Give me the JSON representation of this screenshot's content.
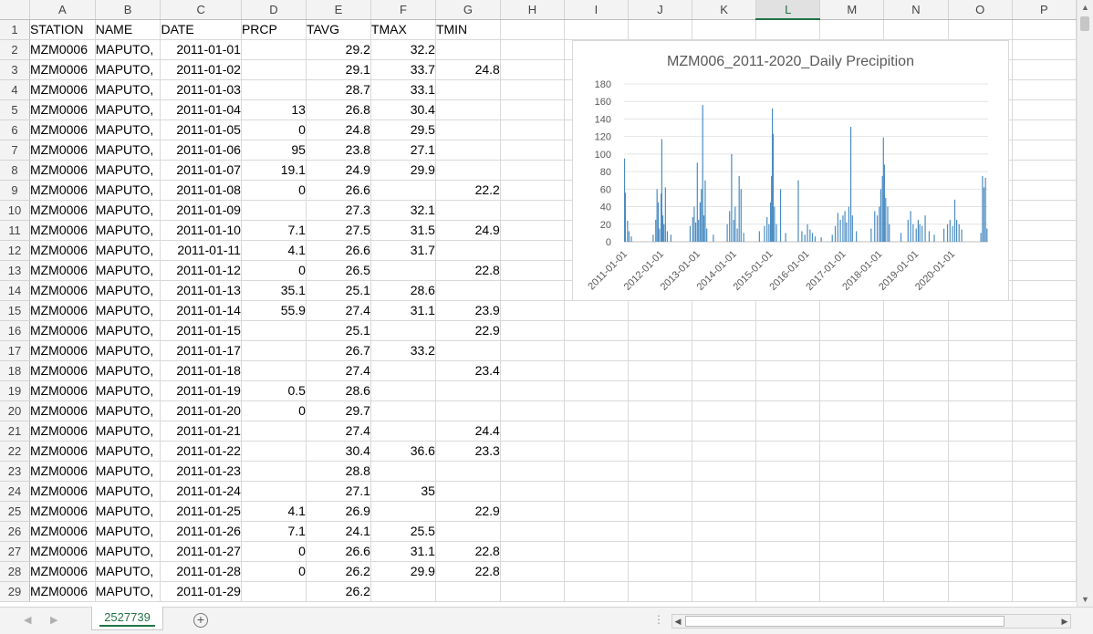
{
  "columns": [
    "",
    "A",
    "B",
    "C",
    "D",
    "E",
    "F",
    "G",
    "H",
    "I",
    "J",
    "K",
    "L",
    "M",
    "N",
    "O",
    "P"
  ],
  "active_column": "L",
  "rows": [
    {
      "n": "1",
      "cells": [
        "STATION",
        "NAME",
        "DATE",
        "PRCP",
        "TAVG",
        "TMAX",
        "TMIN",
        "",
        "",
        "",
        "",
        "",
        "",
        "",
        "",
        ""
      ]
    },
    {
      "n": "2",
      "cells": [
        "MZM0006",
        "MAPUTO,",
        "2011-01-01",
        "",
        "29.2",
        "32.2",
        "",
        "",
        "",
        "",
        "",
        "",
        "",
        "",
        "",
        ""
      ]
    },
    {
      "n": "3",
      "cells": [
        "MZM0006",
        "MAPUTO,",
        "2011-01-02",
        "",
        "29.1",
        "33.7",
        "24.8",
        "",
        "",
        "",
        "",
        "",
        "",
        "",
        "",
        ""
      ]
    },
    {
      "n": "4",
      "cells": [
        "MZM0006",
        "MAPUTO,",
        "2011-01-03",
        "",
        "28.7",
        "33.1",
        "",
        "",
        "",
        "",
        "",
        "",
        "",
        "",
        "",
        ""
      ]
    },
    {
      "n": "5",
      "cells": [
        "MZM0006",
        "MAPUTO,",
        "2011-01-04",
        "13",
        "26.8",
        "30.4",
        "",
        "",
        "",
        "",
        "",
        "",
        "",
        "",
        "",
        ""
      ]
    },
    {
      "n": "6",
      "cells": [
        "MZM0006",
        "MAPUTO,",
        "2011-01-05",
        "0",
        "24.8",
        "29.5",
        "",
        "",
        "",
        "",
        "",
        "",
        "",
        "",
        "",
        ""
      ]
    },
    {
      "n": "7",
      "cells": [
        "MZM0006",
        "MAPUTO,",
        "2011-01-06",
        "95",
        "23.8",
        "27.1",
        "",
        "",
        "",
        "",
        "",
        "",
        "",
        "",
        "",
        ""
      ]
    },
    {
      "n": "8",
      "cells": [
        "MZM0006",
        "MAPUTO,",
        "2011-01-07",
        "19.1",
        "24.9",
        "29.9",
        "",
        "",
        "",
        "",
        "",
        "",
        "",
        "",
        "",
        ""
      ]
    },
    {
      "n": "9",
      "cells": [
        "MZM0006",
        "MAPUTO,",
        "2011-01-08",
        "0",
        "26.6",
        "",
        "22.2",
        "",
        "",
        "",
        "",
        "",
        "",
        "",
        "",
        ""
      ]
    },
    {
      "n": "10",
      "cells": [
        "MZM0006",
        "MAPUTO,",
        "2011-01-09",
        "",
        "27.3",
        "32.1",
        "",
        "",
        "",
        "",
        "",
        "",
        "",
        "",
        "",
        ""
      ]
    },
    {
      "n": "11",
      "cells": [
        "MZM0006",
        "MAPUTO,",
        "2011-01-10",
        "7.1",
        "27.5",
        "31.5",
        "24.9",
        "",
        "",
        "",
        "",
        "",
        "",
        "",
        "",
        ""
      ]
    },
    {
      "n": "12",
      "cells": [
        "MZM0006",
        "MAPUTO,",
        "2011-01-11",
        "4.1",
        "26.6",
        "31.7",
        "",
        "",
        "",
        "",
        "",
        "",
        "",
        "",
        "",
        ""
      ]
    },
    {
      "n": "13",
      "cells": [
        "MZM0006",
        "MAPUTO,",
        "2011-01-12",
        "0",
        "26.5",
        "",
        "22.8",
        "",
        "",
        "",
        "",
        "",
        "",
        "",
        "",
        ""
      ]
    },
    {
      "n": "14",
      "cells": [
        "MZM0006",
        "MAPUTO,",
        "2011-01-13",
        "35.1",
        "25.1",
        "28.6",
        "",
        "",
        "",
        "",
        "",
        "",
        "",
        "",
        "",
        ""
      ]
    },
    {
      "n": "15",
      "cells": [
        "MZM0006",
        "MAPUTO,",
        "2011-01-14",
        "55.9",
        "27.4",
        "31.1",
        "23.9",
        "",
        "",
        "",
        "",
        "",
        "",
        "",
        "",
        ""
      ]
    },
    {
      "n": "16",
      "cells": [
        "MZM0006",
        "MAPUTO,",
        "2011-01-15",
        "",
        "25.1",
        "",
        "22.9",
        "",
        "",
        "",
        "",
        "",
        "",
        "",
        "",
        ""
      ]
    },
    {
      "n": "17",
      "cells": [
        "MZM0006",
        "MAPUTO,",
        "2011-01-17",
        "",
        "26.7",
        "33.2",
        "",
        "",
        "",
        "",
        "",
        "",
        "",
        "",
        "",
        ""
      ]
    },
    {
      "n": "18",
      "cells": [
        "MZM0006",
        "MAPUTO,",
        "2011-01-18",
        "",
        "27.4",
        "",
        "23.4",
        "",
        "",
        "",
        "",
        "",
        "",
        "",
        "",
        ""
      ]
    },
    {
      "n": "19",
      "cells": [
        "MZM0006",
        "MAPUTO,",
        "2011-01-19",
        "0.5",
        "28.6",
        "",
        "",
        "",
        "",
        "",
        "",
        "",
        "",
        "",
        "",
        ""
      ]
    },
    {
      "n": "20",
      "cells": [
        "MZM0006",
        "MAPUTO,",
        "2011-01-20",
        "0",
        "29.7",
        "",
        "",
        "",
        "",
        "",
        "",
        "",
        "",
        "",
        "",
        ""
      ]
    },
    {
      "n": "21",
      "cells": [
        "MZM0006",
        "MAPUTO,",
        "2011-01-21",
        "",
        "27.4",
        "",
        "24.4",
        "",
        "",
        "",
        "",
        "",
        "",
        "",
        "",
        ""
      ]
    },
    {
      "n": "22",
      "cells": [
        "MZM0006",
        "MAPUTO,",
        "2011-01-22",
        "",
        "30.4",
        "36.6",
        "23.3",
        "",
        "",
        "",
        "",
        "",
        "",
        "",
        "",
        ""
      ]
    },
    {
      "n": "23",
      "cells": [
        "MZM0006",
        "MAPUTO,",
        "2011-01-23",
        "",
        "28.8",
        "",
        "",
        "",
        "",
        "",
        "",
        "",
        "",
        "",
        "",
        ""
      ]
    },
    {
      "n": "24",
      "cells": [
        "MZM0006",
        "MAPUTO,",
        "2011-01-24",
        "",
        "27.1",
        "35",
        "",
        "",
        "",
        "",
        "",
        "",
        "",
        "",
        "",
        ""
      ]
    },
    {
      "n": "25",
      "cells": [
        "MZM0006",
        "MAPUTO,",
        "2011-01-25",
        "4.1",
        "26.9",
        "",
        "22.9",
        "",
        "",
        "",
        "",
        "",
        "",
        "",
        "",
        ""
      ]
    },
    {
      "n": "26",
      "cells": [
        "MZM0006",
        "MAPUTO,",
        "2011-01-26",
        "7.1",
        "24.1",
        "25.5",
        "",
        "",
        "",
        "",
        "",
        "",
        "",
        "",
        "",
        ""
      ]
    },
    {
      "n": "27",
      "cells": [
        "MZM0006",
        "MAPUTO,",
        "2011-01-27",
        "0",
        "26.6",
        "31.1",
        "22.8",
        "",
        "",
        "",
        "",
        "",
        "",
        "",
        "",
        ""
      ]
    },
    {
      "n": "28",
      "cells": [
        "MZM0006",
        "MAPUTO,",
        "2011-01-28",
        "0",
        "26.2",
        "29.9",
        "22.8",
        "",
        "",
        "",
        "",
        "",
        "",
        "",
        "",
        ""
      ]
    },
    {
      "n": "29",
      "cells": [
        "MZM0006",
        "MAPUTO,",
        "2011-01-29",
        "",
        "26.2",
        "",
        "",
        "",
        "",
        "",
        "",
        "",
        "",
        "",
        "",
        ""
      ]
    }
  ],
  "sheet_tab": "2527739",
  "colors": {
    "accent": "#217346",
    "series": "#4a8cc2"
  },
  "chart_data": {
    "type": "bar",
    "title": "MZM006_2011-2020_Daily Precipition",
    "xlabel": "",
    "ylabel": "",
    "ylim": [
      0,
      180
    ],
    "yticks": [
      "0",
      "20",
      "40",
      "60",
      "80",
      "100",
      "120",
      "140",
      "160",
      "180"
    ],
    "xticks": [
      "2011-01-01",
      "2012-01-01",
      "2013-01-01",
      "2014-01-01",
      "2015-01-01",
      "2016-01-01",
      "2017-01-01",
      "2018-01-01",
      "2019-01-01",
      "2020-01-01"
    ],
    "x_start": "2011-01-01",
    "x_end": "2020-12-31",
    "series": [
      {
        "values": [
          {
            "x": "2011-01-06",
            "y": 95
          },
          {
            "x": "2011-01-13",
            "y": 35.1
          },
          {
            "x": "2011-01-14",
            "y": 55.9
          },
          {
            "x": "2011-02-05",
            "y": 24
          },
          {
            "x": "2011-02-20",
            "y": 12
          },
          {
            "x": "2011-03-15",
            "y": 6
          },
          {
            "x": "2011-10-20",
            "y": 8
          },
          {
            "x": "2011-11-15",
            "y": 25
          },
          {
            "x": "2011-11-28",
            "y": 60
          },
          {
            "x": "2011-12-10",
            "y": 45
          },
          {
            "x": "2011-12-22",
            "y": 15
          },
          {
            "x": "2012-01-08",
            "y": 55
          },
          {
            "x": "2012-01-15",
            "y": 117
          },
          {
            "x": "2012-01-25",
            "y": 30
          },
          {
            "x": "2012-02-05",
            "y": 20
          },
          {
            "x": "2012-02-20",
            "y": 62
          },
          {
            "x": "2012-03-10",
            "y": 12
          },
          {
            "x": "2012-04-15",
            "y": 8
          },
          {
            "x": "2012-10-25",
            "y": 18
          },
          {
            "x": "2012-11-20",
            "y": 28
          },
          {
            "x": "2012-12-05",
            "y": 40
          },
          {
            "x": "2012-12-20",
            "y": 22
          },
          {
            "x": "2013-01-05",
            "y": 90
          },
          {
            "x": "2013-01-18",
            "y": 25
          },
          {
            "x": "2013-02-02",
            "y": 45
          },
          {
            "x": "2013-02-15",
            "y": 60
          },
          {
            "x": "2013-02-28",
            "y": 156
          },
          {
            "x": "2013-03-12",
            "y": 30
          },
          {
            "x": "2013-03-25",
            "y": 70
          },
          {
            "x": "2013-04-10",
            "y": 15
          },
          {
            "x": "2013-06-15",
            "y": 8
          },
          {
            "x": "2013-11-01",
            "y": 20
          },
          {
            "x": "2013-11-25",
            "y": 35
          },
          {
            "x": "2013-12-15",
            "y": 100
          },
          {
            "x": "2014-01-05",
            "y": 25
          },
          {
            "x": "2014-01-20",
            "y": 40
          },
          {
            "x": "2014-02-10",
            "y": 15
          },
          {
            "x": "2014-03-01",
            "y": 75
          },
          {
            "x": "2014-03-20",
            "y": 60
          },
          {
            "x": "2014-04-15",
            "y": 10
          },
          {
            "x": "2014-09-20",
            "y": 12
          },
          {
            "x": "2014-11-10",
            "y": 18
          },
          {
            "x": "2014-12-05",
            "y": 28
          },
          {
            "x": "2014-12-25",
            "y": 20
          },
          {
            "x": "2015-01-10",
            "y": 45
          },
          {
            "x": "2015-01-20",
            "y": 75
          },
          {
            "x": "2015-01-28",
            "y": 152
          },
          {
            "x": "2015-02-05",
            "y": 123
          },
          {
            "x": "2015-02-18",
            "y": 40
          },
          {
            "x": "2015-03-10",
            "y": 20
          },
          {
            "x": "2015-04-20",
            "y": 60
          },
          {
            "x": "2015-06-10",
            "y": 10
          },
          {
            "x": "2015-10-15",
            "y": 70
          },
          {
            "x": "2015-11-20",
            "y": 12
          },
          {
            "x": "2015-12-20",
            "y": 8
          },
          {
            "x": "2016-01-15",
            "y": 20
          },
          {
            "x": "2016-02-10",
            "y": 14
          },
          {
            "x": "2016-03-05",
            "y": 10
          },
          {
            "x": "2016-04-01",
            "y": 6
          },
          {
            "x": "2016-06-01",
            "y": 5
          },
          {
            "x": "2016-09-20",
            "y": 8
          },
          {
            "x": "2016-10-20",
            "y": 18
          },
          {
            "x": "2016-11-15",
            "y": 33
          },
          {
            "x": "2016-12-10",
            "y": 25
          },
          {
            "x": "2017-01-05",
            "y": 30
          },
          {
            "x": "2017-01-25",
            "y": 35
          },
          {
            "x": "2017-02-10",
            "y": 22
          },
          {
            "x": "2017-03-05",
            "y": 40
          },
          {
            "x": "2017-03-25",
            "y": 131
          },
          {
            "x": "2017-04-10",
            "y": 30
          },
          {
            "x": "2017-05-20",
            "y": 12
          },
          {
            "x": "2017-10-15",
            "y": 15
          },
          {
            "x": "2017-11-20",
            "y": 35
          },
          {
            "x": "2017-12-15",
            "y": 30
          },
          {
            "x": "2018-01-05",
            "y": 40
          },
          {
            "x": "2018-01-20",
            "y": 60
          },
          {
            "x": "2018-02-05",
            "y": 75
          },
          {
            "x": "2018-02-15",
            "y": 119
          },
          {
            "x": "2018-02-25",
            "y": 88
          },
          {
            "x": "2018-03-10",
            "y": 50
          },
          {
            "x": "2018-03-30",
            "y": 40
          },
          {
            "x": "2018-04-15",
            "y": 20
          },
          {
            "x": "2018-08-10",
            "y": 10
          },
          {
            "x": "2018-10-20",
            "y": 25
          },
          {
            "x": "2018-11-15",
            "y": 35
          },
          {
            "x": "2018-12-10",
            "y": 20
          },
          {
            "x": "2019-01-10",
            "y": 15
          },
          {
            "x": "2019-01-30",
            "y": 25
          },
          {
            "x": "2019-02-15",
            "y": 20
          },
          {
            "x": "2019-03-10",
            "y": 18
          },
          {
            "x": "2019-04-10",
            "y": 30
          },
          {
            "x": "2019-05-20",
            "y": 12
          },
          {
            "x": "2019-07-10",
            "y": 8
          },
          {
            "x": "2019-10-15",
            "y": 15
          },
          {
            "x": "2019-11-20",
            "y": 20
          },
          {
            "x": "2019-12-15",
            "y": 25
          },
          {
            "x": "2020-01-10",
            "y": 18
          },
          {
            "x": "2020-02-01",
            "y": 48
          },
          {
            "x": "2020-02-20",
            "y": 25
          },
          {
            "x": "2020-03-15",
            "y": 20
          },
          {
            "x": "2020-04-10",
            "y": 14
          },
          {
            "x": "2020-10-20",
            "y": 10
          },
          {
            "x": "2020-11-05",
            "y": 75
          },
          {
            "x": "2020-11-20",
            "y": 62
          },
          {
            "x": "2020-12-05",
            "y": 73
          },
          {
            "x": "2020-12-20",
            "y": 15
          }
        ]
      }
    ]
  }
}
